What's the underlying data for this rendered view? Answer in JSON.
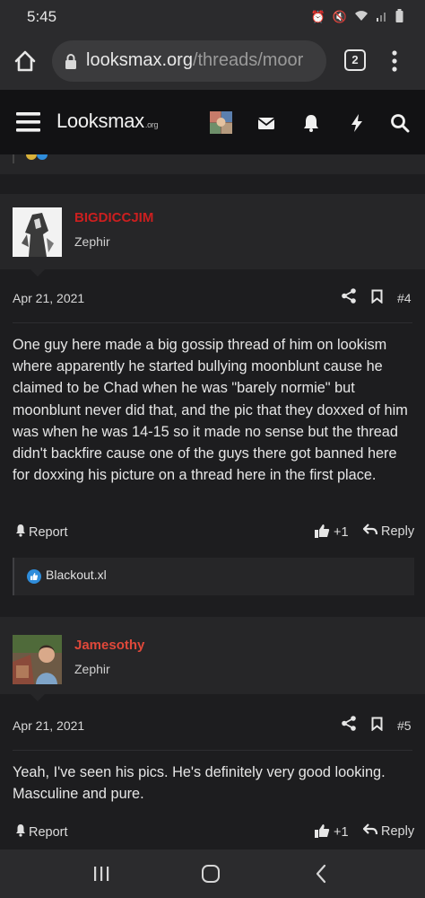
{
  "status": {
    "time": "5:45"
  },
  "browser": {
    "url_host": "looksmax.org",
    "url_path": "/threads/moor",
    "tab_count": "2"
  },
  "site": {
    "logo_main": "Looksmax",
    "logo_sub": ".org"
  },
  "posts": [
    {
      "username": "BIGDICCJIM",
      "username_color": "#cc1f1f",
      "role": "Zephir",
      "date": "Apr 21, 2021",
      "number": "#4",
      "body": "One guy here made a big gossip thread of him on lookism where apparently he started bullying moonblunt cause he claimed to be Chad when he was \"barely normie\" but moonblunt never did that, and the pic that they doxxed of him was when he was 14-15 so it made no sense but the thread didn't backfire cause one of the guys there got banned here for doxxing his picture on a thread here in the first place.",
      "report_label": "Report",
      "like_count": "+1",
      "reply_label": "Reply",
      "reaction_user": "Blackout.xl"
    },
    {
      "username": "Jamesothy",
      "username_color": "#e0483a",
      "role": "Zephir",
      "date": "Apr 21, 2021",
      "number": "#5",
      "body": "Yeah, I've seen his pics. He's definitely very good looking. Masculine and pure.",
      "report_label": "Report",
      "like_count": "+1",
      "reply_label": "Reply"
    }
  ],
  "colors": {
    "accent_blue": "#2f8ddb",
    "background": "#1d1d1f",
    "panel": "#262628"
  }
}
